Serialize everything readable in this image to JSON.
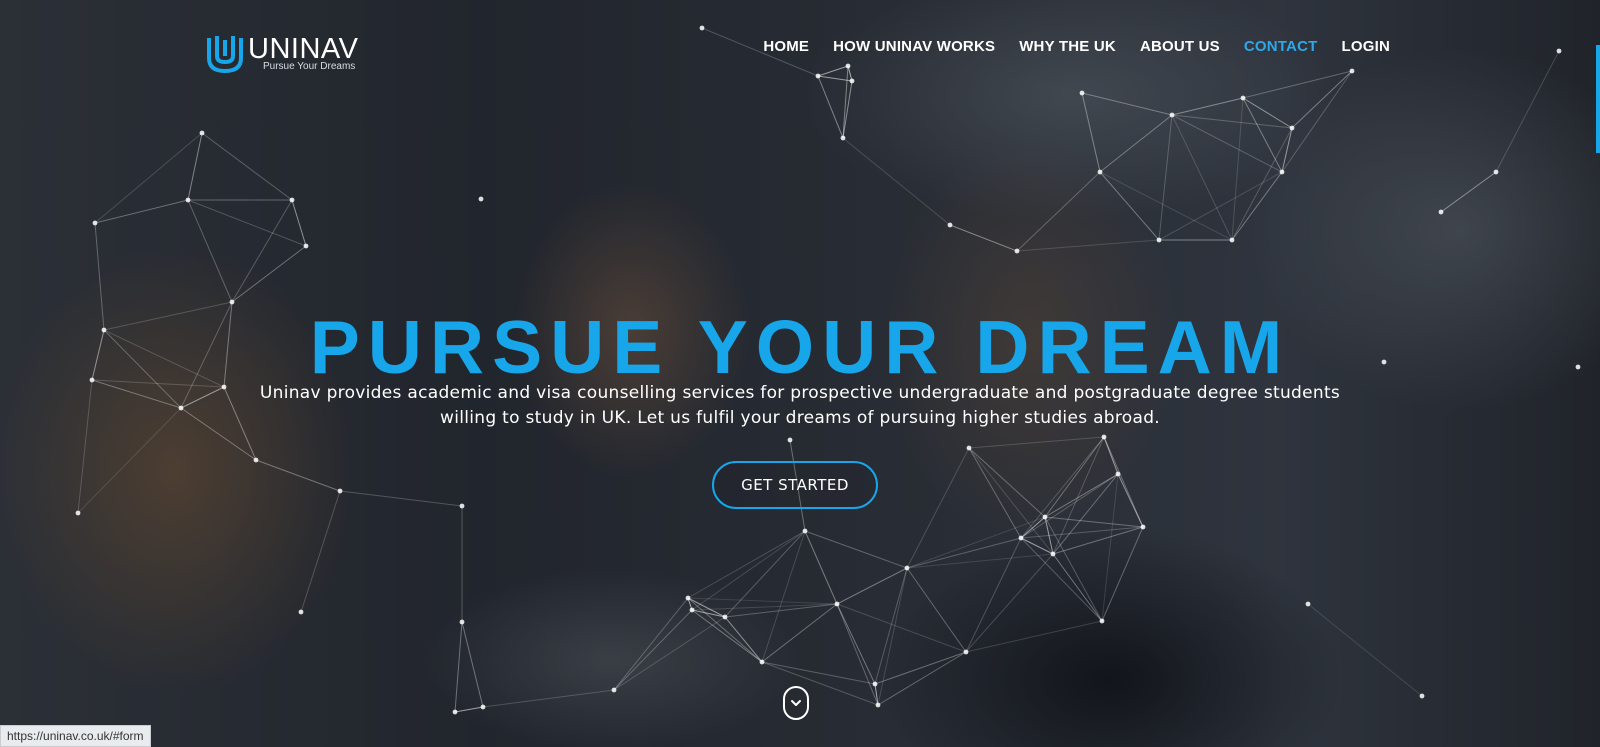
{
  "brand": {
    "name": "UNINAV",
    "tagline": "Pursue Your Dreams",
    "accent_color": "#17a6ea"
  },
  "nav": {
    "items": [
      {
        "label": "HOME"
      },
      {
        "label": "HOW UNINAV WORKS"
      },
      {
        "label": "WHY THE UK"
      },
      {
        "label": "ABOUT US"
      },
      {
        "label": "CONTACT",
        "active": true
      },
      {
        "label": "LOGIN"
      }
    ]
  },
  "hero": {
    "headline": "PURSUE YOUR DREAM",
    "subtext": "Uninav provides academic and visa counselling services for prospective undergraduate and postgraduate degree students willing to study in UK. Let us fulfil your dreams of pursuing higher studies abroad.",
    "cta_label": "GET STARTED",
    "scroll_icon": "chevron-down-icon"
  },
  "status_bar": {
    "url": "https://uninav.co.uk/#form"
  }
}
